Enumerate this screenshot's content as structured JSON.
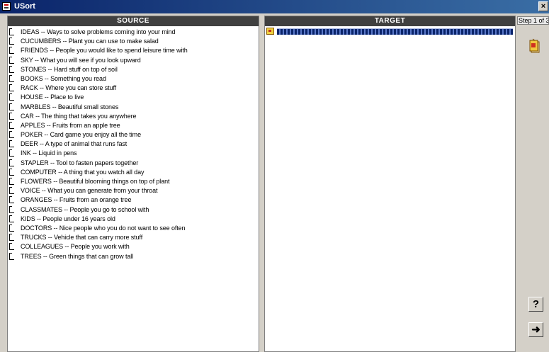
{
  "window": {
    "title": "USort",
    "close_label": "×"
  },
  "source": {
    "header": "SOURCE",
    "items": [
      "IDEAS -- Ways to solve problems coming into your mind",
      "CUCUMBERS -- Plant you can use to make salad",
      "FRIENDS -- People you would like to spend leisure time with",
      "SKY -- What you will see if you look upward",
      "STONES -- Hard stuff on top of soil",
      "BOOKS -- Something you read",
      "RACK -- Where you can store stuff",
      "HOUSE -- Place to live",
      "MARBLES -- Beautiful small stones",
      "CAR -- The thing that takes you anywhere",
      "APPLES -- Fruits from an apple tree",
      "POKER -- Card game you enjoy all the time",
      "DEER -- A type of animal that runs fast",
      "INK -- Liquid in pens",
      "STAPLER -- Tool to fasten papers together",
      "COMPUTER -- A thing that you watch all day",
      "FLOWERS -- Beautiful blooming things on top of plant",
      "VOICE -- What you can generate from your throat",
      "ORANGES -- Fruits from an orange tree",
      "CLASSMATES -- People you go to school with",
      "KIDS -- People under 16  years old",
      "DOCTORS -- Nice people who you do not want to see often",
      "TRUCKS -- Vehicle that can carry more stuff",
      "COLLEAGUES -- People you work with",
      "TREES -- Green things that can grow tall"
    ]
  },
  "target": {
    "header": "TARGET"
  },
  "side": {
    "step_label": "Step 1 of 3",
    "help_label": "?",
    "next_label": "➜",
    "icons": {
      "group": "card-pile-icon",
      "next": "arrow-right-icon"
    }
  },
  "colors": {
    "title_bar": "#0a246a",
    "header_bg": "#404040",
    "selection": "#0a246a",
    "window_bg": "#d4d0c8"
  }
}
